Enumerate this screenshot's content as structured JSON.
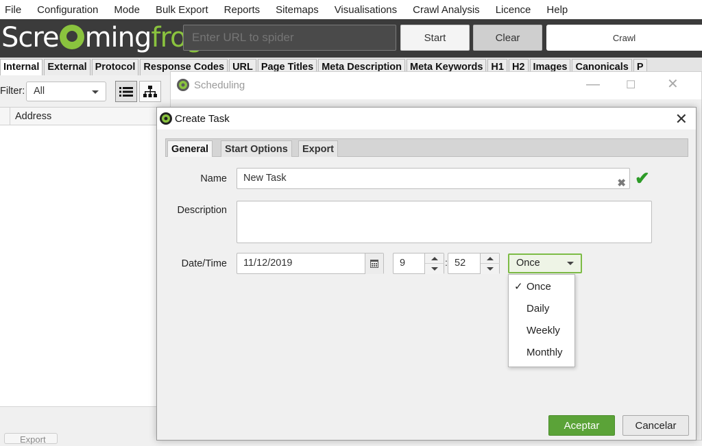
{
  "menu": [
    "File",
    "Configuration",
    "Mode",
    "Bulk Export",
    "Reports",
    "Sitemaps",
    "Visualisations",
    "Crawl Analysis",
    "Licence",
    "Help"
  ],
  "header": {
    "logo_text_a": "Scre",
    "logo_text_b": "ming",
    "logo_text_c": "frog",
    "url_placeholder": "Enter URL to spider",
    "start_label": "Start",
    "clear_label": "Clear",
    "crawl_label": "Crawl"
  },
  "tabs": [
    "Internal",
    "External",
    "Protocol",
    "Response Codes",
    "URL",
    "Page Titles",
    "Meta Description",
    "Meta Keywords",
    "H1",
    "H2",
    "Images",
    "Canonicals",
    "P"
  ],
  "filter": {
    "label": "Filter:",
    "value": "All"
  },
  "table": {
    "address_header": "Address"
  },
  "export_label": "Export",
  "scheduling": {
    "title": "Scheduling"
  },
  "dialog": {
    "title": "Create Task",
    "tabs": [
      "General",
      "Start Options",
      "Export"
    ],
    "name_label": "Name",
    "name_value": "New Task",
    "description_label": "Description",
    "description_value": "",
    "datetime_label": "Date/Time",
    "date_value": "11/12/2019",
    "hour_value": "9",
    "minute_value": "52",
    "time_sep": ":",
    "frequency_value": "Once",
    "frequency_options": [
      "Once",
      "Daily",
      "Weekly",
      "Monthly"
    ],
    "selected_option": "Once",
    "ok_label": "Aceptar",
    "cancel_label": "Cancelar"
  },
  "colors": {
    "accent_green": "#5ba338",
    "header_bg": "#3b3b3b",
    "logo_green": "#8ac33e"
  }
}
